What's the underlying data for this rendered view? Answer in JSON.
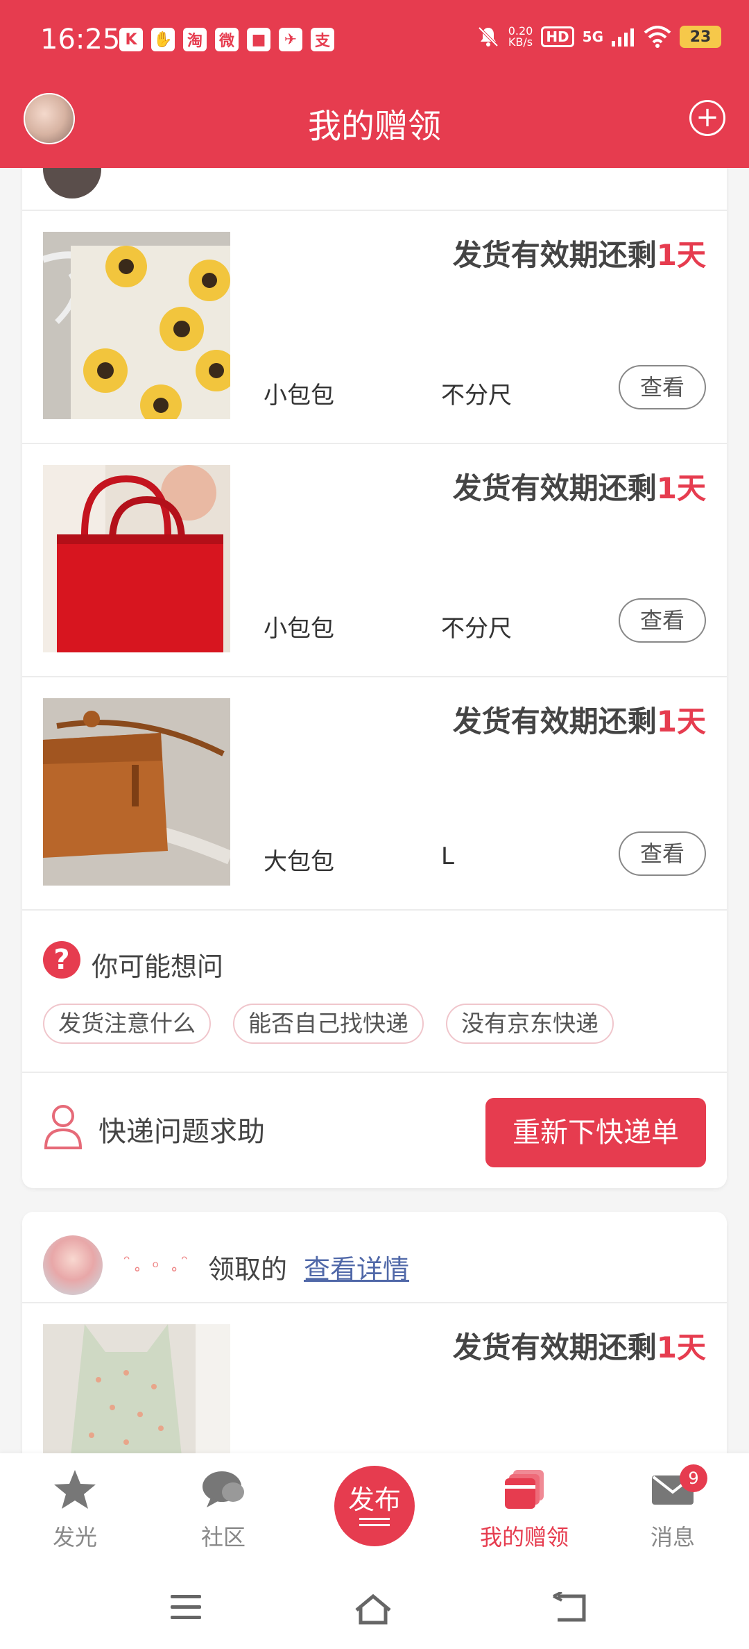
{
  "status_bar": {
    "time": "16:25",
    "notif_icons": [
      "K",
      "✋",
      "淘",
      "微",
      "■",
      "✈",
      "支"
    ],
    "net_speed_value": "0.20",
    "net_speed_unit": "KB/s",
    "hd": "HD",
    "signal": "5G",
    "battery": "23"
  },
  "header": {
    "title": "我的赠领",
    "add_label": "+"
  },
  "card1": {
    "items": [
      {
        "deadline_prefix": "发货有效期还剩",
        "deadline_remain": "1天",
        "name": "小包包",
        "size": "不分尺",
        "view_label": "查看"
      },
      {
        "deadline_prefix": "发货有效期还剩",
        "deadline_remain": "1天",
        "name": "小包包",
        "size": "不分尺",
        "view_label": "查看"
      },
      {
        "deadline_prefix": "发货有效期还剩",
        "deadline_remain": "1天",
        "name": "大包包",
        "size": "L",
        "view_label": "查看"
      }
    ],
    "faq": {
      "icon": "?",
      "title": "你可能想问",
      "chips": [
        "发货注意什么",
        "能否自己找快递",
        "没有京东快递"
      ]
    },
    "help": {
      "title": "快递问题求助",
      "button": "重新下快递单"
    }
  },
  "card2": {
    "claimer_name_dots": "ᵔ˳ ₒ ˳ᵔ",
    "claim_text": "领取的",
    "detail_link": "查看详情",
    "item": {
      "deadline_prefix": "发货有效期还剩",
      "deadline_remain": "1天"
    }
  },
  "bottom_nav": {
    "items": [
      {
        "label": "发光",
        "icon": "star-icon"
      },
      {
        "label": "社区",
        "icon": "chat-bubble-icon"
      },
      {
        "label": "发布",
        "icon": "publish-icon"
      },
      {
        "label": "我的赠领",
        "icon": "gift-cards-icon"
      },
      {
        "label": "消息",
        "icon": "mail-icon"
      }
    ],
    "message_badge": "9",
    "active": "我的赠领"
  },
  "colors": {
    "accent": "#e63c4f",
    "link": "#5068a8"
  }
}
